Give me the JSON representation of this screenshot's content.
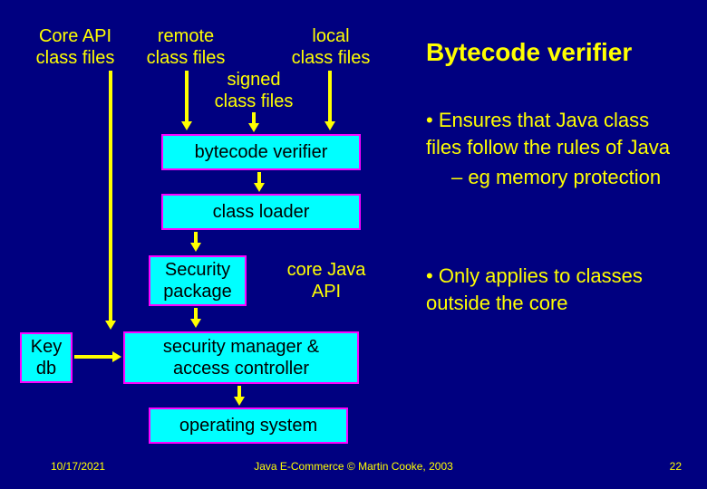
{
  "diagram": {
    "core_api": "Core API\nclass files",
    "remote": "remote\nclass files",
    "local": "local\nclass files",
    "signed": "signed\nclass files",
    "bytecode_verifier": "bytecode verifier",
    "class_loader": "class loader",
    "security_package": "Security\npackage",
    "core_java_api": "core Java\nAPI",
    "key_db": "Key\ndb",
    "sec_mgr": "security manager &\naccess controller",
    "os": "operating system"
  },
  "text": {
    "title": "Bytecode verifier",
    "bullet1": "Ensures that Java class files follow the rules of Java",
    "bullet1_sub": "eg memory protection",
    "bullet2": "Only applies to classes outside the core"
  },
  "footer": {
    "date": "10/17/2021",
    "copyright": "Java E-Commerce © Martin Cooke, 2003",
    "page": "22"
  }
}
